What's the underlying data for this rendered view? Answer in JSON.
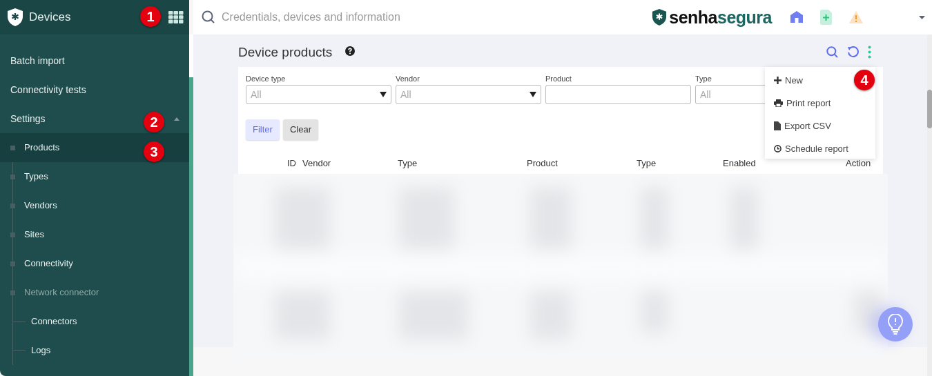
{
  "sidebar": {
    "title": "Devices",
    "items": [
      {
        "label": "Batch import",
        "selected": false,
        "disabled": false
      },
      {
        "label": "Connectivity tests",
        "selected": false,
        "disabled": false
      },
      {
        "label": "Settings",
        "selected": false,
        "disabled": false,
        "expanded": true,
        "children": [
          {
            "label": "Products",
            "selected": true,
            "disabled": false
          },
          {
            "label": "Types",
            "selected": false,
            "disabled": false
          },
          {
            "label": "Vendors",
            "selected": false,
            "disabled": false
          },
          {
            "label": "Sites",
            "selected": false,
            "disabled": false
          },
          {
            "label": "Connectivity",
            "selected": false,
            "disabled": false
          },
          {
            "label": "Network connector",
            "selected": false,
            "disabled": true,
            "children": [
              {
                "label": "Connectors",
                "selected": false,
                "disabled": false
              },
              {
                "label": "Logs",
                "selected": false,
                "disabled": false
              }
            ]
          }
        ]
      }
    ]
  },
  "search": {
    "placeholder": "Credentials, devices and information"
  },
  "logo": {
    "first": "senha",
    "second": "segura"
  },
  "page": {
    "title": "Device products"
  },
  "filters": [
    {
      "kind": "select",
      "label": "Device type",
      "value": "All"
    },
    {
      "kind": "select",
      "label": "Vendor",
      "value": "All"
    },
    {
      "kind": "text",
      "label": "Product"
    },
    {
      "kind": "select",
      "label": "Type",
      "value": "All"
    }
  ],
  "buttons": [
    {
      "label": "Filter",
      "kind": "primary"
    },
    {
      "label": "Clear",
      "kind": "secondary"
    }
  ],
  "table": {
    "columns": [
      "ID",
      "Vendor",
      "Type",
      "Product",
      "Type",
      "Enabled",
      "Action"
    ]
  },
  "menu": [
    {
      "kind": "plus",
      "label": "New"
    },
    {
      "kind": "print",
      "label": "Print report"
    },
    {
      "kind": "file",
      "label": "Export CSV"
    },
    {
      "kind": "clock",
      "label": "Schedule report"
    }
  ],
  "annotations": [
    "1",
    "2",
    "3",
    "4"
  ]
}
